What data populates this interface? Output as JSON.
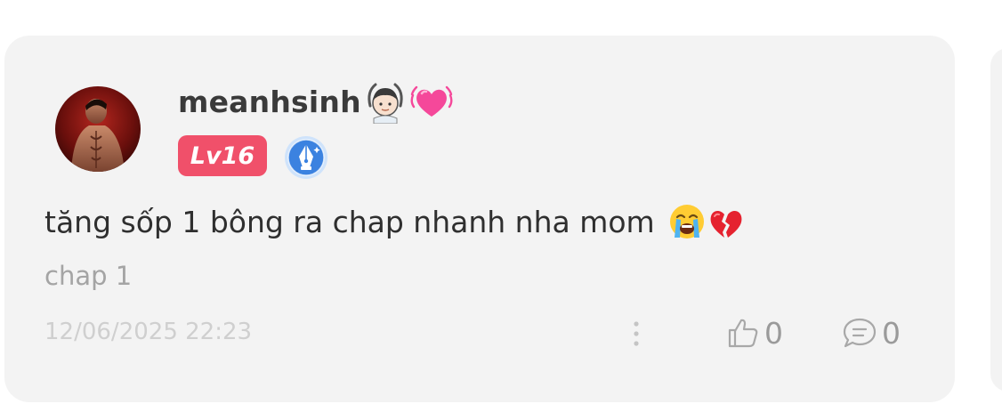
{
  "comment": {
    "username": "meanhsinh",
    "name_emojis": [
      "person-gesturing-ok-icon",
      "beating-heart-icon"
    ],
    "level": "Lv16",
    "badge": "pen-nib-badge-icon",
    "text": "tăng sốp 1 bông ra chap nhanh nha mom",
    "text_emojis": [
      "crying-face-icon",
      "broken-heart-icon"
    ],
    "chapter": "chap 1",
    "timestamp": "12/06/2025 22:23",
    "likes": "0",
    "replies": "0"
  },
  "colors": {
    "card_bg": "#f3f3f3",
    "level_badge": "#f0506a",
    "muted_text": "#a4a4a4",
    "timestamp_text": "#cfcfcf",
    "body_text": "#2f2f2f",
    "badge_blue": "#3b82e0"
  }
}
